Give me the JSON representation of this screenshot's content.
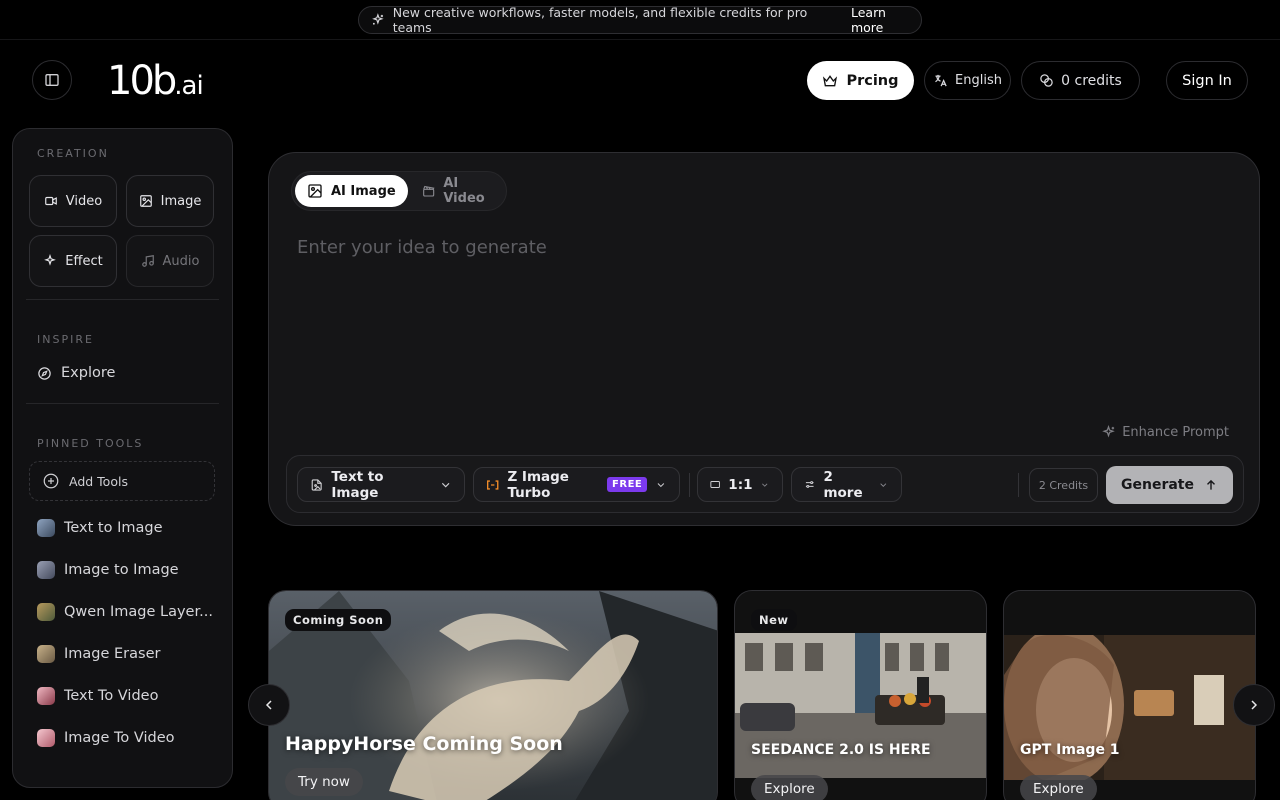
{
  "announcement": {
    "text": "New creative workflows, faster models, and flexible credits for pro teams",
    "link": "Learn more"
  },
  "header": {
    "logo_main": "10b",
    "logo_suffix": ".ai",
    "pricing": "Prcing",
    "language": "English",
    "credits": "0 credits",
    "sign_in": "Sign In"
  },
  "sidebar": {
    "creation_label": "CREATION",
    "creation_items": [
      {
        "label": "Video",
        "icon": "video-camera-icon"
      },
      {
        "label": "Image",
        "icon": "image-icon"
      },
      {
        "label": "Effect",
        "icon": "sparkles-icon"
      },
      {
        "label": "Audio",
        "icon": "music-note-icon"
      }
    ],
    "inspire_label": "INSPIRE",
    "explore": "Explore",
    "pinned_label": "PINNED TOOLS",
    "add_tools": "Add Tools",
    "tools": [
      {
        "label": "Text to Image",
        "color": "#5a6b82"
      },
      {
        "label": "Image to Image",
        "color": "#6b7286"
      },
      {
        "label": "Qwen Image Layer...",
        "color": "#7a6a4a"
      },
      {
        "label": "Image Eraser",
        "color": "#8a7b60"
      },
      {
        "label": "Text To Video",
        "color": "#c46a7a"
      },
      {
        "label": "Image To Video",
        "color": "#d58a96"
      }
    ]
  },
  "composer": {
    "tabs": [
      {
        "label": "AI Image",
        "active": true
      },
      {
        "label": "AI Video",
        "active": false
      }
    ],
    "placeholder": "Enter your idea to generate",
    "enhance": "Enhance Prompt",
    "mode": "Text to Image",
    "model": "Z Image Turbo",
    "model_badge": "FREE",
    "ratio": "1:1",
    "more": "2 more",
    "cost": "2 Credits",
    "generate": "Generate",
    "accent": "#7c3aed"
  },
  "carousel": [
    {
      "badge": "Coming Soon",
      "title": "HappyHorse Coming Soon",
      "button": "Try now"
    },
    {
      "badge": "New",
      "title": "SEEDANCE 2.0 IS HERE",
      "button": "Explore"
    },
    {
      "badge": "",
      "title": "GPT Image 1",
      "button": "Explore"
    }
  ]
}
